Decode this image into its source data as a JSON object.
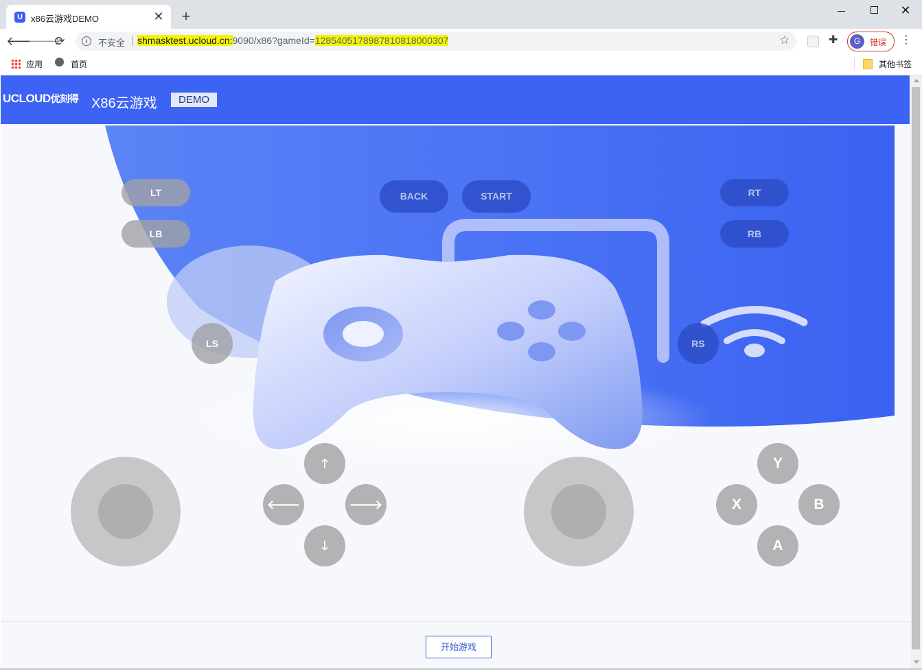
{
  "browser": {
    "tab_title": "x86云游戏DEMO",
    "tab_favicon": "U",
    "tab_close": "✕",
    "new_tab": "+",
    "win_close": "✕",
    "security_label": "不安全",
    "url_host": "shmasktest.ucloud.cn:",
    "url_mid": "9090/x86?gameId=",
    "url_gameid": "1285405178987810818000307",
    "profile_initial": "G",
    "profile_status": "错误",
    "bookmarks": {
      "apps": "应用",
      "home": "首页",
      "other": "其他书签"
    },
    "icons": [
      "back-icon",
      "forward-icon",
      "reload-icon",
      "info-icon",
      "star-icon",
      "puzzle-icon",
      "menu-icon",
      "apps-icon",
      "globe-icon",
      "folder-icon"
    ]
  },
  "header": {
    "logo": "UCLOUD",
    "logo_cn": "优刻得",
    "title": "X86云游戏",
    "badge": "DEMO"
  },
  "gamepad": {
    "lt": "LT",
    "lb": "LB",
    "rt": "RT",
    "rb": "RB",
    "back": "BACK",
    "start": "START",
    "ls": "LS",
    "rs": "RS",
    "dpad": {
      "up": "🡑",
      "left": "🡐",
      "right": "🡒",
      "down": "🡓"
    },
    "face": {
      "y": "Y",
      "x": "X",
      "b": "B",
      "a": "A"
    }
  },
  "footer": {
    "start_button": "开始游戏"
  },
  "colors": {
    "brand_blue": "#3d63f5",
    "button_grey": "#b3b3b6",
    "page_bg": "#f7f8fc"
  }
}
